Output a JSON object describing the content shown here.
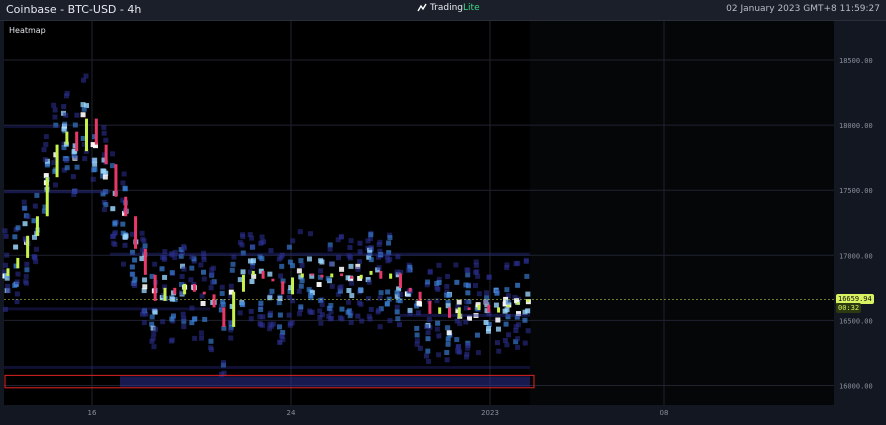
{
  "header": {
    "title": "Coinbase - BTC-USD - 4h",
    "brand_main": "Trading",
    "brand_accent": "Lite",
    "datetime": "02 January 2023 GMT+8 11:59:27"
  },
  "panel": {
    "label": "Heatmap"
  },
  "colors": {
    "background": "#000000",
    "up_candle": "#c6f24b",
    "down_candle": "#e8386a",
    "heat_low": "#2b2f8f",
    "heat_mid": "#3a7fd6",
    "heat_high": "#9ad6ff",
    "heat_max": "#ffffff",
    "highlight_box": "#e02424",
    "last_price": "#d8f261"
  },
  "chart_data": {
    "type": "candlestick_heatmap",
    "y_ticks": [
      "18500.00",
      "18000.00",
      "17500.00",
      "17000.00",
      "16500.00",
      "16000.00"
    ],
    "y_tick_values": [
      18500,
      18000,
      17500,
      17000,
      16500,
      16000
    ],
    "x_ticks": [
      "16",
      "24",
      "2023",
      "08"
    ],
    "ylim": [
      15850,
      18800
    ],
    "last_price_label": "16659.94",
    "last_price": 16659.94,
    "countdown_label": "00:32",
    "grid": true,
    "price_series": [
      {
        "t": 0,
        "c": 16900
      },
      {
        "t": 1,
        "c": 16980
      },
      {
        "t": 2,
        "c": 17150
      },
      {
        "t": 3,
        "c": 17300
      },
      {
        "t": 4,
        "c": 17600
      },
      {
        "t": 5,
        "c": 17850
      },
      {
        "t": 6,
        "c": 17950
      },
      {
        "t": 7,
        "c": 17800
      },
      {
        "t": 8,
        "c": 18050
      },
      {
        "t": 9,
        "c": 17850
      },
      {
        "t": 10,
        "c": 17700
      },
      {
        "t": 11,
        "c": 17450
      },
      {
        "t": 12,
        "c": 17300
      },
      {
        "t": 13,
        "c": 17050
      },
      {
        "t": 14,
        "c": 16850
      },
      {
        "t": 15,
        "c": 16650
      },
      {
        "t": 16,
        "c": 16750
      },
      {
        "t": 17,
        "c": 16700
      },
      {
        "t": 18,
        "c": 16780
      },
      {
        "t": 19,
        "c": 16720
      },
      {
        "t": 20,
        "c": 16700
      },
      {
        "t": 21,
        "c": 16600
      },
      {
        "t": 22,
        "c": 16450
      },
      {
        "t": 23,
        "c": 16720
      },
      {
        "t": 24,
        "c": 16850
      },
      {
        "t": 25,
        "c": 16880
      },
      {
        "t": 26,
        "c": 16820
      },
      {
        "t": 27,
        "c": 16800
      },
      {
        "t": 28,
        "c": 16700
      },
      {
        "t": 29,
        "c": 16830
      },
      {
        "t": 30,
        "c": 16860
      },
      {
        "t": 31,
        "c": 16850
      },
      {
        "t": 32,
        "c": 16830
      },
      {
        "t": 33,
        "c": 16860
      },
      {
        "t": 34,
        "c": 16840
      },
      {
        "t": 35,
        "c": 16820
      },
      {
        "t": 36,
        "c": 16850
      },
      {
        "t": 37,
        "c": 16880
      },
      {
        "t": 38,
        "c": 16820
      },
      {
        "t": 39,
        "c": 16860
      },
      {
        "t": 40,
        "c": 16750
      },
      {
        "t": 41,
        "c": 16720
      },
      {
        "t": 42,
        "c": 16650
      },
      {
        "t": 43,
        "c": 16550
      },
      {
        "t": 44,
        "c": 16600
      },
      {
        "t": 45,
        "c": 16520
      },
      {
        "t": 46,
        "c": 16600
      },
      {
        "t": 47,
        "c": 16580
      },
      {
        "t": 48,
        "c": 16620
      },
      {
        "t": 49,
        "c": 16560
      },
      {
        "t": 50,
        "c": 16600
      },
      {
        "t": 51,
        "c": 16620
      },
      {
        "t": 52,
        "c": 16640
      },
      {
        "t": 53,
        "c": 16660
      }
    ],
    "highlight_band": [
      15990,
      16070
    ]
  }
}
